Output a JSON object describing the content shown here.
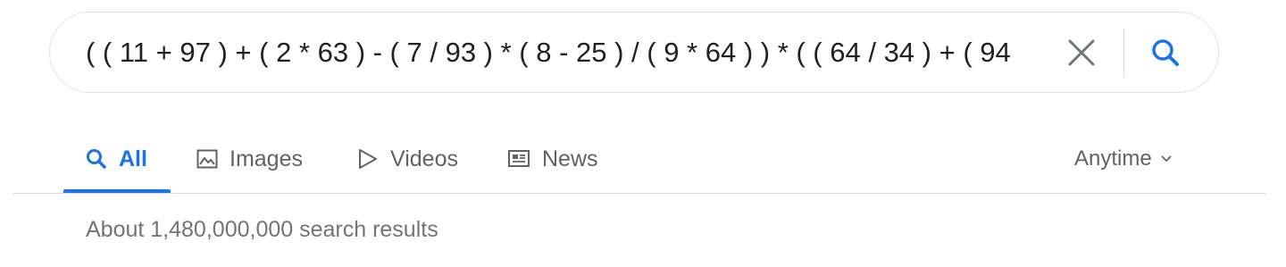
{
  "search": {
    "query": "( ( 11 + 97 ) + ( 2 * 63 ) - ( 7 / 93 ) * ( 8 - 25 ) / ( 9 * 64 ) ) * ( ( 64 / 34 ) + ( 94",
    "clear_icon": "close-icon",
    "search_icon": "search-icon"
  },
  "tabs": [
    {
      "label": "All",
      "icon": "search-icon",
      "active": true
    },
    {
      "label": "Images",
      "icon": "image-icon",
      "active": false
    },
    {
      "label": "Videos",
      "icon": "play-icon",
      "active": false
    },
    {
      "label": "News",
      "icon": "news-icon",
      "active": false
    }
  ],
  "filter": {
    "label": "Anytime",
    "icon": "chevron-down-icon"
  },
  "results": {
    "count_text": "About 1,480,000,000 search results"
  },
  "colors": {
    "accent": "#1a73e8",
    "text_primary": "#202124",
    "text_secondary": "#5f6368",
    "border": "#dfe1e5"
  }
}
